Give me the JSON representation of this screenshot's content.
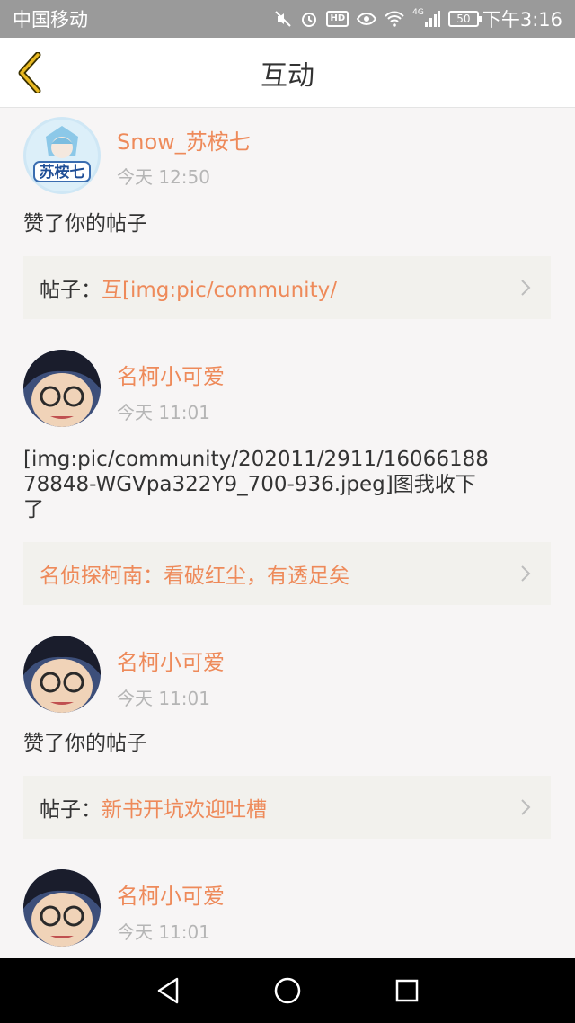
{
  "status_bar": {
    "carrier": "中国移动",
    "network": "4G",
    "battery": "50",
    "time": "下午3:16",
    "icons": [
      "mute-icon",
      "alarm-icon",
      "hd-icon",
      "eye-icon",
      "wifi-icon",
      "signal-icon",
      "battery-icon"
    ]
  },
  "header": {
    "title": "互动",
    "back_icon": "chevron-left-icon",
    "accent": "#e8b820"
  },
  "colors": {
    "name": "#ee8a5a",
    "time": "#b5b5b5",
    "card_bg": "#f2f1ed",
    "page_bg": "#f7f5f5"
  },
  "items": [
    {
      "user": "Snow_苏桉七",
      "avatar_text": "苏桉七",
      "time": "今天 12:50",
      "action": "赞了你的帖子",
      "post_prefix": "帖子：",
      "post_title": "互[img:pic/community/"
    },
    {
      "user": "名柯小可爱",
      "time": "今天 11:01",
      "action": "[img:pic/community/202011/2911/1606618878848-WGVpa322Y9_700-936.jpeg]图我收下了",
      "post_prefix": "",
      "post_title": "名侦探柯南：看破红尘，有透足矣"
    },
    {
      "user": "名柯小可爱",
      "time": "今天 11:01",
      "action": "赞了你的帖子",
      "post_prefix": "帖子：",
      "post_title": "新书开坑欢迎吐槽"
    },
    {
      "user": "名柯小可爱",
      "time": "今天 11:01"
    }
  ],
  "nav_bar": {
    "icons": [
      "back-triangle-icon",
      "home-circle-icon",
      "recents-square-icon"
    ]
  }
}
